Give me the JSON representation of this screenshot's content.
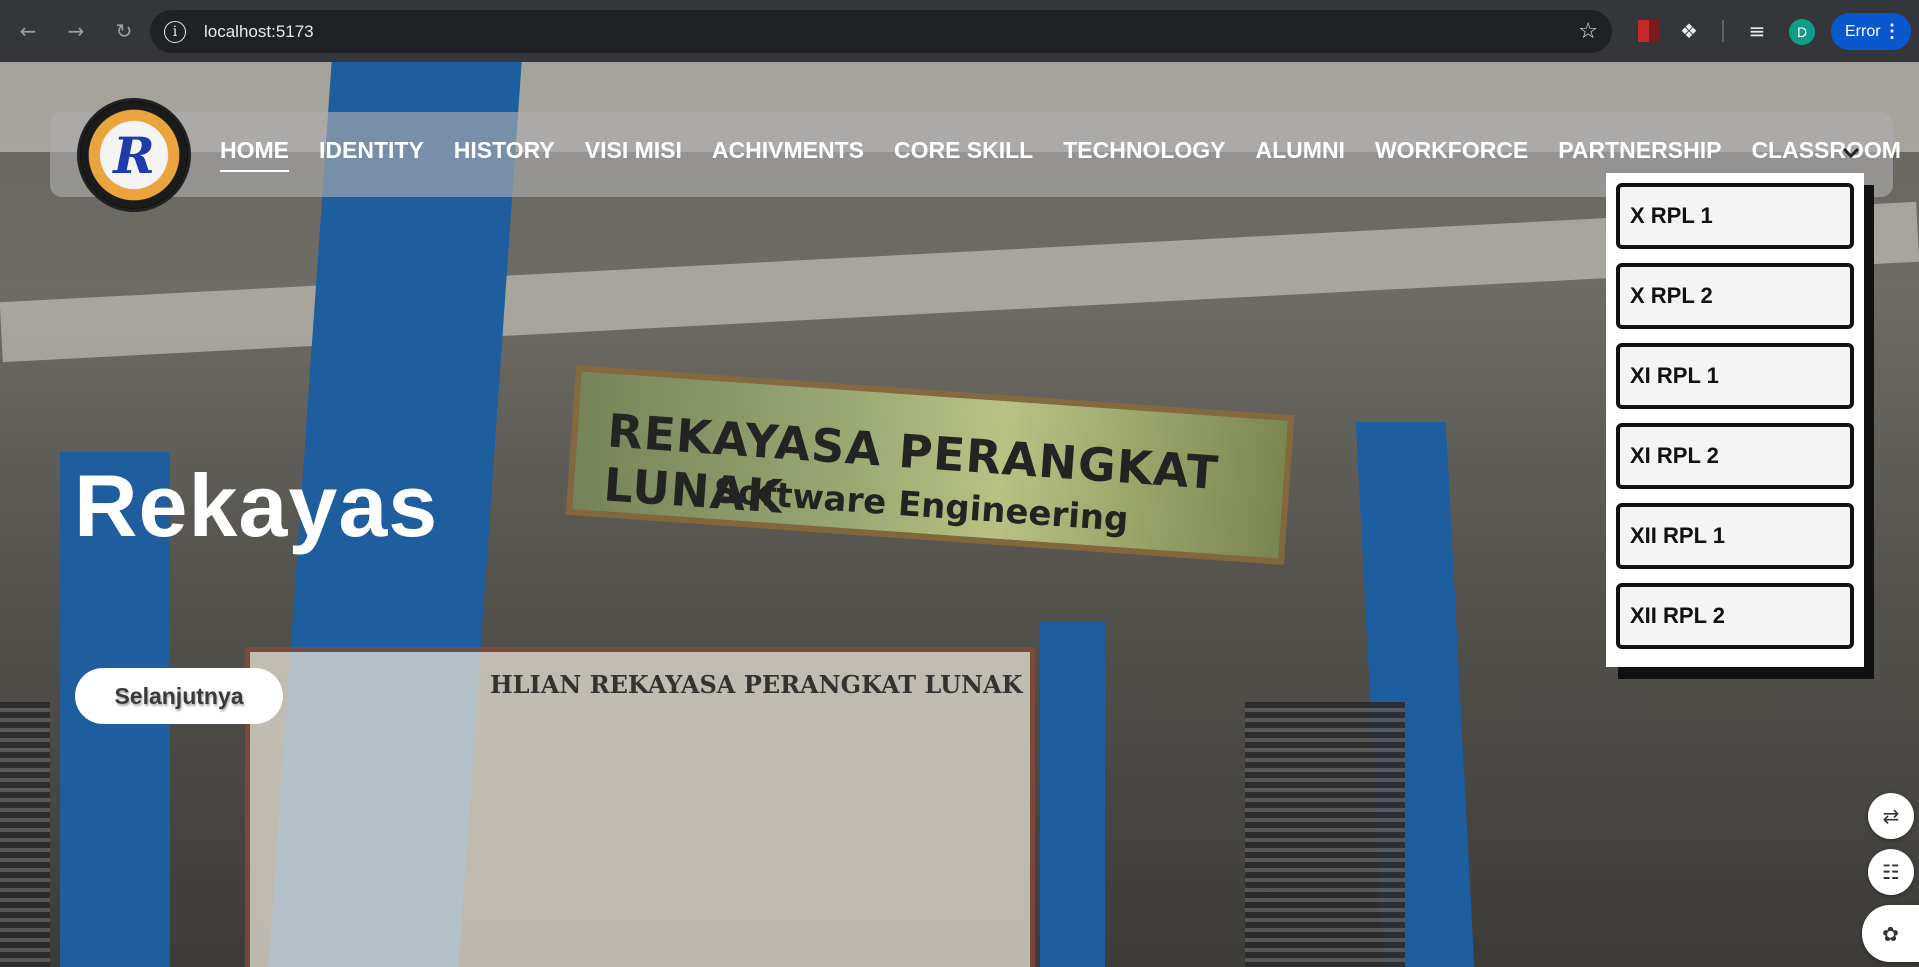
{
  "browser": {
    "url": "localhost:5173",
    "profile_initial": "D",
    "error_label": "Error",
    "icons": [
      "back-arrow-icon",
      "forward-arrow-icon",
      "reload-icon",
      "site-info-icon",
      "bookmark-star-icon",
      "extension-icon",
      "puzzle-icon",
      "media-control-icon",
      "menu-dots-icon"
    ]
  },
  "navbar": {
    "items": [
      {
        "label": "HOME",
        "active": true
      },
      {
        "label": "IDENTITY"
      },
      {
        "label": "HISTORY"
      },
      {
        "label": "VISI MISI"
      },
      {
        "label": "ACHIVMENTS"
      },
      {
        "label": "CORE SKILL"
      },
      {
        "label": "TECHNOLOGY"
      },
      {
        "label": "ALUMNI"
      },
      {
        "label": "WORKFORCE"
      },
      {
        "label": "PARTNERSHIP"
      },
      {
        "label": "CLASSROOM"
      }
    ]
  },
  "dropdown": {
    "items": [
      "X RPL 1",
      "X RPL 2",
      "XI RPL 1",
      "XI RPL 2",
      "XII RPL 1",
      "XII RPL 2"
    ]
  },
  "hero": {
    "title": "Rekayas",
    "button_label": "Selanjutnya"
  },
  "background": {
    "sign_title": "REKAYASA PERANGKAT LUNAK",
    "sign_subtitle": "Software Engineering",
    "board_title": "HLIAN REKAYASA PERANGKAT LUNAK"
  },
  "colors": {
    "navbar_bg": "#afafaf",
    "dropdown_border": "#111111",
    "error_pill": "#0b57d0",
    "pillar_blue": "#1e5d9e"
  }
}
